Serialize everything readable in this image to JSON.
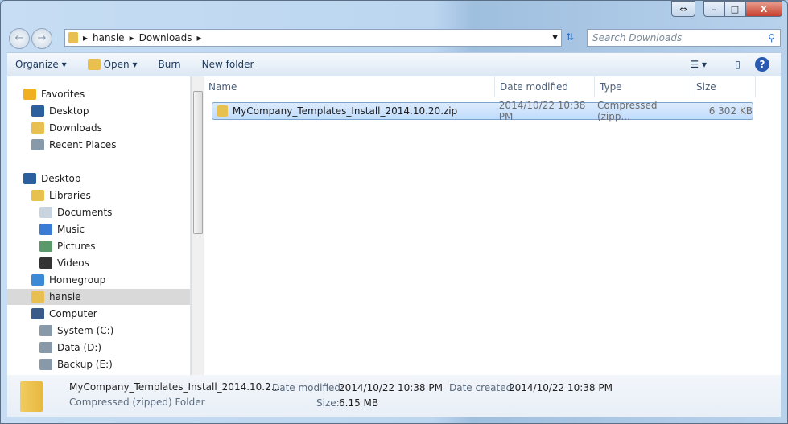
{
  "window": {
    "caption": {
      "minimize": "–",
      "maximize": "□",
      "close": "X",
      "resize": "⇔"
    }
  },
  "address": {
    "segments": [
      "hansie",
      "Downloads"
    ],
    "search_placeholder": "Search Downloads"
  },
  "toolbar": {
    "organize": "Organize ▾",
    "open": "Open ▾",
    "burn": "Burn",
    "new_folder": "New folder"
  },
  "sidebar": {
    "items": [
      {
        "label": "Favorites",
        "color": "#f0b020",
        "indent": 0
      },
      {
        "label": "Desktop",
        "color": "#2b5f9e",
        "indent": 1
      },
      {
        "label": "Downloads",
        "color": "#e8c050",
        "indent": 1
      },
      {
        "label": "Recent Places",
        "color": "#8899aa",
        "indent": 1
      },
      {
        "label": "Desktop",
        "color": "#2b5f9e",
        "indent": 0
      },
      {
        "label": "Libraries",
        "color": "#e8c050",
        "indent": 1
      },
      {
        "label": "Documents",
        "color": "#c8d4e0",
        "indent": 2
      },
      {
        "label": "Music",
        "color": "#3a7bd5",
        "indent": 2
      },
      {
        "label": "Pictures",
        "color": "#5a9a6a",
        "indent": 2
      },
      {
        "label": "Videos",
        "color": "#333333",
        "indent": 2
      },
      {
        "label": "Homegroup",
        "color": "#3a8ad5",
        "indent": 1
      },
      {
        "label": "hansie",
        "color": "#e8c050",
        "indent": 1,
        "selected": true
      },
      {
        "label": "Computer",
        "color": "#3a5a8a",
        "indent": 1
      },
      {
        "label": "System (C:)",
        "color": "#8899aa",
        "indent": 2
      },
      {
        "label": "Data (D:)",
        "color": "#8899aa",
        "indent": 2
      },
      {
        "label": "Backup (E:)",
        "color": "#8899aa",
        "indent": 2
      }
    ]
  },
  "columns": {
    "name": "Name",
    "date": "Date modified",
    "type": "Type",
    "size": "Size"
  },
  "files": [
    {
      "name": "MyCompany_Templates_Install_2014.10.20.zip",
      "date": "2014/10/22 10:38 PM",
      "type": "Compressed (zipp...",
      "size": "6 302 KB"
    }
  ],
  "details": {
    "name": "MyCompany_Templates_Install_2014.10.2...",
    "kind": "Compressed (zipped) Folder",
    "date_modified_label": "Date modified:",
    "date_modified": "2014/10/22 10:38 PM",
    "date_created_label": "Date created:",
    "date_created": "2014/10/22 10:38 PM",
    "size_label": "Size:",
    "size": "6.15 MB"
  }
}
